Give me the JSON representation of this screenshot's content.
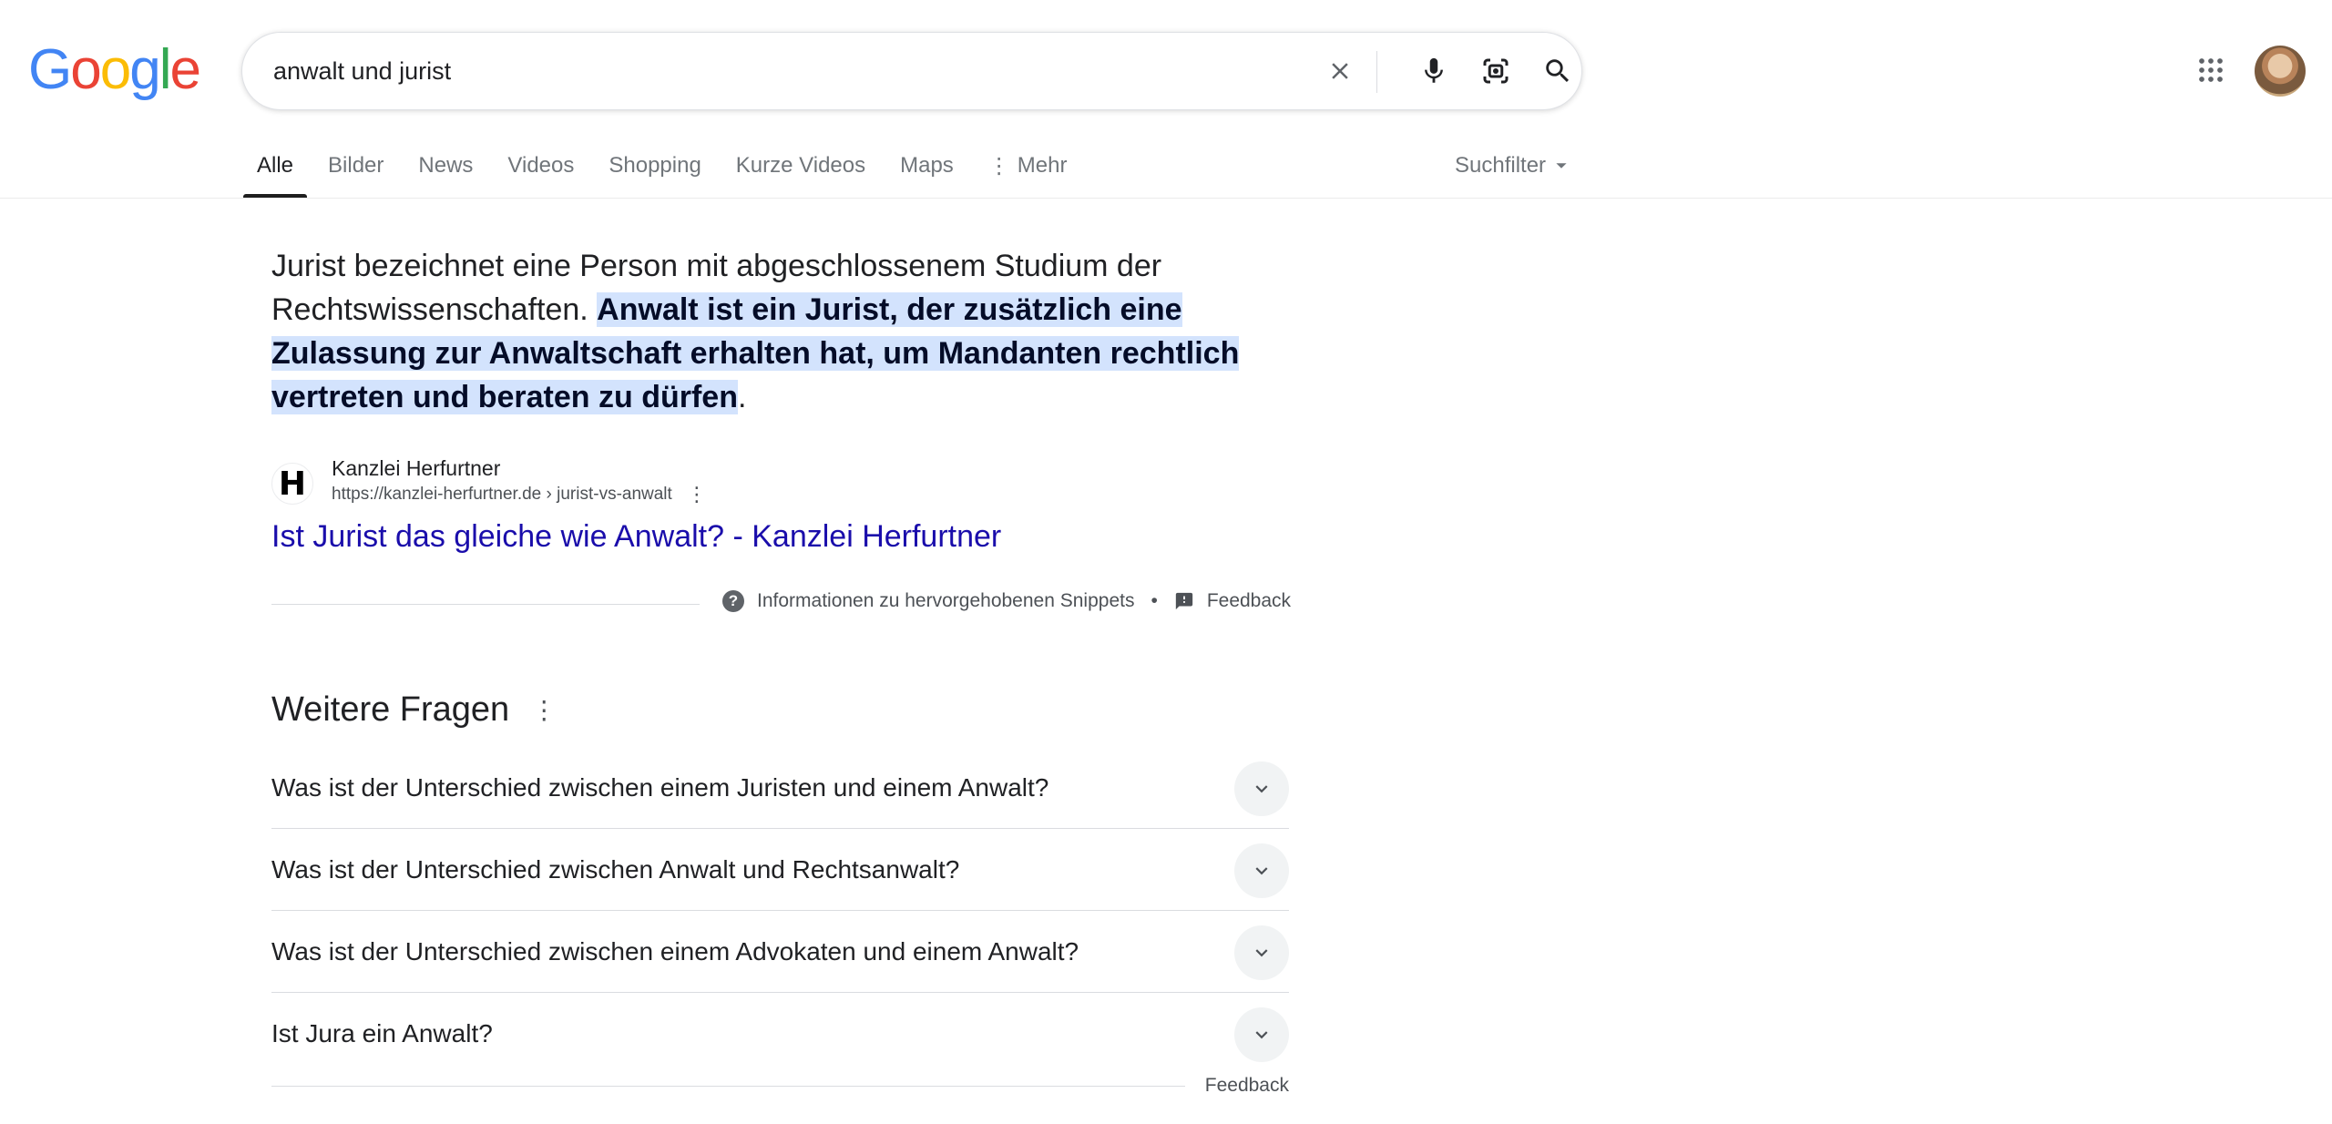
{
  "logo": {
    "letters": [
      "G",
      "o",
      "o",
      "g",
      "l",
      "e"
    ],
    "colors": [
      "#4285F4",
      "#EA4335",
      "#FBBC05",
      "#4285F4",
      "#34A853",
      "#EA4335"
    ]
  },
  "search": {
    "query": "anwalt und jurist",
    "icons": [
      "clear-icon",
      "microphone-icon",
      "lens-icon",
      "search-icon"
    ]
  },
  "tabs": [
    {
      "label": "Alle",
      "active": true
    },
    {
      "label": "Bilder"
    },
    {
      "label": "News"
    },
    {
      "label": "Videos"
    },
    {
      "label": "Shopping"
    },
    {
      "label": "Kurze Videos"
    },
    {
      "label": "Maps"
    },
    {
      "label": "Mehr"
    }
  ],
  "suchfilter_label": "Suchfilter",
  "snippet": {
    "text_before": "Jurist bezeichnet eine Person mit abgeschlossenem Studium der Rechtswissenschaften. ",
    "highlight": "Anwalt ist ein Jurist, der zusätzlich eine Zulassung zur Anwaltschaft erhalten hat, um Mandanten rechtlich vertreten und beraten zu dürfen",
    "text_after": ".",
    "source_name": "Kanzlei Herfurtner",
    "source_url": "https://kanzlei-herfurtner.de › jurist-vs-anwalt",
    "favicon_letter": "H",
    "result_title": "Ist Jurist das gleiche wie Anwalt? - Kanzlei Herfurtner",
    "info_label": "Informationen zu hervorgehobenen Snippets",
    "feedback_label": "Feedback"
  },
  "paa": {
    "title": "Weitere Fragen",
    "questions": [
      "Was ist der Unterschied zwischen einem Juristen und einem Anwalt?",
      "Was ist der Unterschied zwischen Anwalt und Rechtsanwalt?",
      "Was ist der Unterschied zwischen einem Advokaten und einem Anwalt?",
      "Ist Jura ein Anwalt?"
    ],
    "feedback_label": "Feedback"
  },
  "colors": {
    "link": "#1a0dab",
    "highlight": "#d3e3fd"
  }
}
